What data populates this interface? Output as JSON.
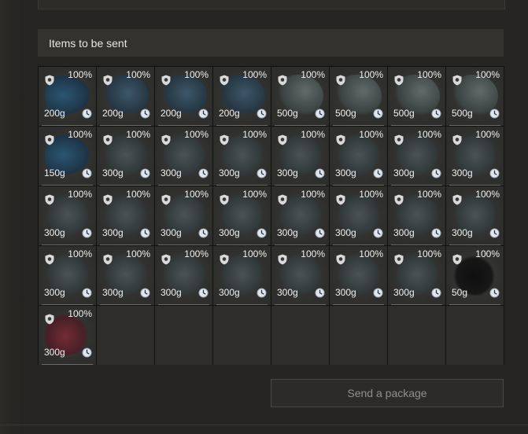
{
  "section": {
    "title": "Items to be sent"
  },
  "actions": {
    "send_label": "Send a package"
  },
  "items": [
    {
      "pct": "100%",
      "weight": "200g",
      "thumb": "t-blue"
    },
    {
      "pct": "100%",
      "weight": "200g",
      "thumb": "t-claw"
    },
    {
      "pct": "100%",
      "weight": "200g",
      "thumb": "t-claw"
    },
    {
      "pct": "100%",
      "weight": "200g",
      "thumb": "t-claw"
    },
    {
      "pct": "100%",
      "weight": "500g",
      "thumb": "t-bone"
    },
    {
      "pct": "100%",
      "weight": "500g",
      "thumb": "t-bone"
    },
    {
      "pct": "100%",
      "weight": "500g",
      "thumb": "t-bone"
    },
    {
      "pct": "100%",
      "weight": "500g",
      "thumb": "t-bone"
    },
    {
      "pct": "100%",
      "weight": "150g",
      "thumb": "t-blue"
    },
    {
      "pct": "100%",
      "weight": "300g",
      "thumb": "t-gray"
    },
    {
      "pct": "100%",
      "weight": "300g",
      "thumb": "t-gray"
    },
    {
      "pct": "100%",
      "weight": "300g",
      "thumb": "t-gray"
    },
    {
      "pct": "100%",
      "weight": "300g",
      "thumb": "t-gray"
    },
    {
      "pct": "100%",
      "weight": "300g",
      "thumb": "t-gray"
    },
    {
      "pct": "100%",
      "weight": "300g",
      "thumb": "t-gray"
    },
    {
      "pct": "100%",
      "weight": "300g",
      "thumb": "t-gray"
    },
    {
      "pct": "100%",
      "weight": "300g",
      "thumb": "t-gray"
    },
    {
      "pct": "100%",
      "weight": "300g",
      "thumb": "t-gray"
    },
    {
      "pct": "100%",
      "weight": "300g",
      "thumb": "t-gray"
    },
    {
      "pct": "100%",
      "weight": "300g",
      "thumb": "t-gray"
    },
    {
      "pct": "100%",
      "weight": "300g",
      "thumb": "t-gray"
    },
    {
      "pct": "100%",
      "weight": "300g",
      "thumb": "t-gray"
    },
    {
      "pct": "100%",
      "weight": "300g",
      "thumb": "t-gray"
    },
    {
      "pct": "100%",
      "weight": "300g",
      "thumb": "t-gray"
    },
    {
      "pct": "100%",
      "weight": "300g",
      "thumb": "t-gray"
    },
    {
      "pct": "100%",
      "weight": "300g",
      "thumb": "t-gray"
    },
    {
      "pct": "100%",
      "weight": "300g",
      "thumb": "t-gray"
    },
    {
      "pct": "100%",
      "weight": "300g",
      "thumb": "t-gray"
    },
    {
      "pct": "100%",
      "weight": "300g",
      "thumb": "t-gray"
    },
    {
      "pct": "100%",
      "weight": "300g",
      "thumb": "t-gray"
    },
    {
      "pct": "100%",
      "weight": "300g",
      "thumb": "t-gray"
    },
    {
      "pct": "100%",
      "weight": "50g",
      "thumb": "t-black"
    },
    {
      "pct": "100%",
      "weight": "300g",
      "thumb": "t-red"
    }
  ],
  "empty_slots": 7,
  "icons": {
    "protect": "shield-icon",
    "timer": "clock-icon"
  },
  "colors": {
    "ok_underline": "#3f8a46",
    "background": "#262523"
  }
}
